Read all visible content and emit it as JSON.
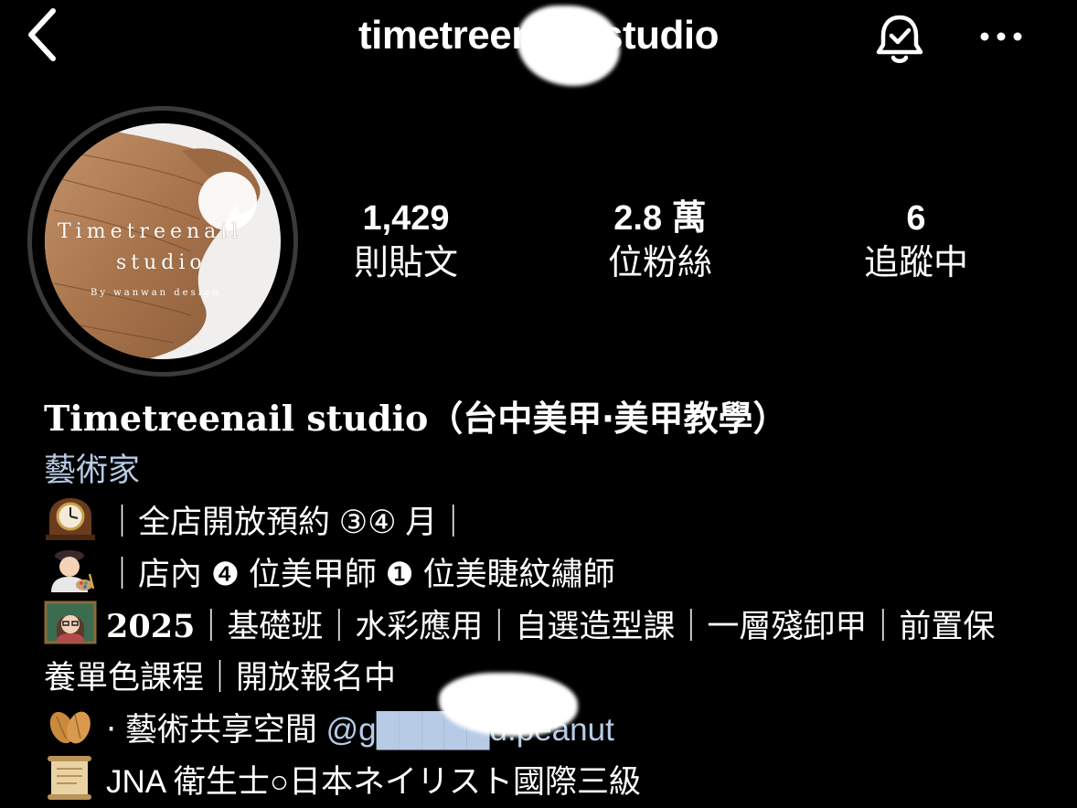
{
  "header": {
    "username": "timetreenail_studio",
    "icons": {
      "back": "chevron-left-icon",
      "notifications": "bell-check-icon",
      "more": "more-dots-icon"
    }
  },
  "avatar": {
    "line1": "Timetreenail",
    "line2": "studio",
    "line3": "By wanwan design"
  },
  "stats": [
    {
      "value": "1,429",
      "label": "則貼文"
    },
    {
      "value": "2.8 萬",
      "label": "位粉絲"
    },
    {
      "value": "6",
      "label": "追蹤中"
    }
  ],
  "bio": {
    "name_latin": "Timetreenail studio",
    "name_cjk": "（台中美甲‧美甲教學）",
    "category": "藝術家",
    "line1": "｜全店開放預約 ③④ 月｜",
    "line2": "｜店內 ❹ 位美甲師 ❶ 位美睫紋繡師",
    "line3_year": "2025",
    "line3_text": "｜基礎班｜水彩應用｜自選造型課｜一層殘卸甲｜前置保",
    "line4": "養單色課程｜開放報名中",
    "line5_text": "‧ 藝術共享空間 ",
    "line5_mention": "@g█████d.peanut",
    "line6": "JNA 衛生士○日本ネイリスト國際三級"
  },
  "colors": {
    "background": "#000000",
    "text": "#ffffff",
    "link": "#b7cbe6",
    "ring": "#3a3a3a"
  }
}
